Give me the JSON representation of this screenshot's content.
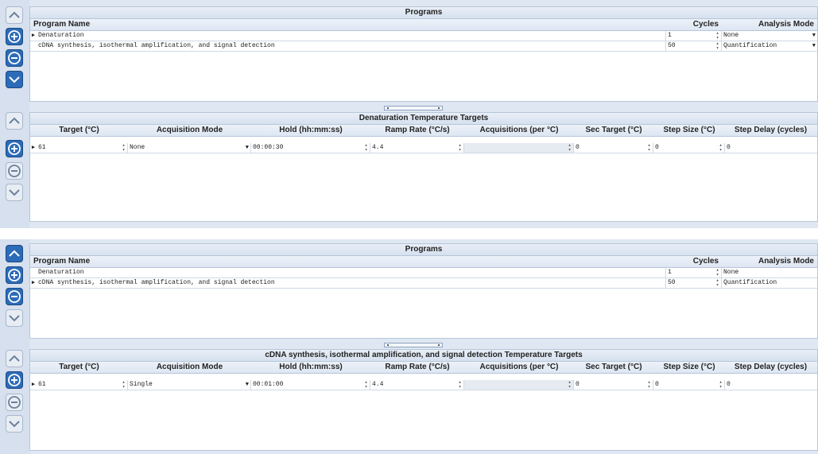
{
  "panels": [
    {
      "programs": {
        "title": "Programs",
        "headers": [
          "Program Name",
          "Cycles",
          "Analysis Mode"
        ],
        "rows": [
          {
            "name": "Denaturation",
            "cycles": "1",
            "mode": "None",
            "selected": true
          },
          {
            "name": "cDNA synthesis, isothermal amplification,  and signal detection",
            "cycles": "50",
            "mode": "Quantification",
            "selected": false
          }
        ]
      },
      "targets": {
        "title": "Denaturation Temperature Targets",
        "headers": [
          "Target (°C)",
          "Acquisition Mode",
          "Hold (hh:mm:ss)",
          "Ramp Rate (°C/s)",
          "Acquisitions (per °C)",
          "Sec Target (°C)",
          "Step Size (°C)",
          "Step Delay (cycles)"
        ],
        "row": {
          "target": "61",
          "acq_mode": "None",
          "hold": "00:00:30",
          "ramp": "4.4",
          "acquisitions": "",
          "sec_target": "0",
          "step_size": "0",
          "step_delay": "0"
        }
      }
    },
    {
      "programs": {
        "title": "Programs",
        "headers": [
          "Program Name",
          "Cycles",
          "Analysis Mode"
        ],
        "rows": [
          {
            "name": "Denaturation",
            "cycles": "1",
            "mode": "None",
            "selected": false
          },
          {
            "name": "cDNA synthesis, isothermal amplification,  and signal detection",
            "cycles": "50",
            "mode": "Quantification",
            "selected": true
          }
        ]
      },
      "targets": {
        "title": "cDNA synthesis, isothermal amplification,  and signal detection Temperature Targets",
        "headers": [
          "Target (°C)",
          "Acquisition Mode",
          "Hold (hh:mm:ss)",
          "Ramp Rate (°C/s)",
          "Acquisitions (per °C)",
          "Sec Target (°C)",
          "Step Size (°C)",
          "Step Delay (cycles)"
        ],
        "row": {
          "target": "61",
          "acq_mode": "Single",
          "hold": "00:01:00",
          "ramp": "4.4",
          "acquisitions": "",
          "sec_target": "0",
          "step_size": "0",
          "step_delay": "0"
        }
      }
    }
  ],
  "icons": {
    "up": "chevron-up-icon",
    "add": "plus-circle-icon",
    "remove": "minus-circle-icon",
    "down": "chevron-down-icon"
  },
  "colors": {
    "accent": "#2c6bb8",
    "panel_bg": "#dfe7f2",
    "header_bg": "#dce6f2"
  }
}
